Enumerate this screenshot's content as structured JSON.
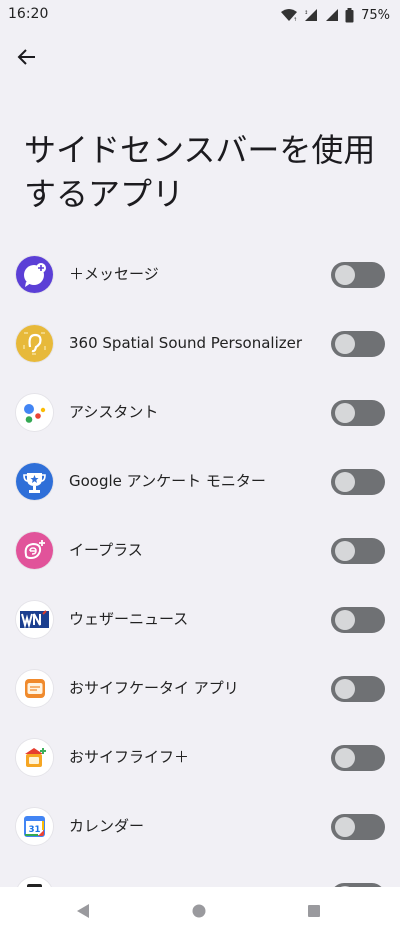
{
  "status_bar": {
    "time": "16:20",
    "battery": "75%"
  },
  "header": {
    "back_icon": "arrow-left-icon",
    "title": "サイドセンスバーを使用するアプリ"
  },
  "apps": [
    {
      "label": "＋メッセージ",
      "icon": "plus-message-icon",
      "enabled": false
    },
    {
      "label": "360 Spatial Sound Personalizer",
      "icon": "ear-icon",
      "enabled": false
    },
    {
      "label": "アシスタント",
      "icon": "google-assistant-icon",
      "enabled": false
    },
    {
      "label": "Google アンケート モニター",
      "icon": "trophy-icon",
      "enabled": false
    },
    {
      "label": "イープラス",
      "icon": "eplus-icon",
      "enabled": false
    },
    {
      "label": "ウェザーニュース",
      "icon": "weathernews-icon",
      "enabled": false
    },
    {
      "label": "おサイフケータイ アプリ",
      "icon": "osaifu-keitai-icon",
      "enabled": false
    },
    {
      "label": "おサイフライフ＋",
      "icon": "osaifu-life-icon",
      "enabled": false
    },
    {
      "label": "カレンダー",
      "icon": "calendar-icon",
      "enabled": false
    },
    {
      "label": "",
      "icon": "partial-app-icon",
      "enabled": false
    }
  ],
  "calendar_day": "31",
  "colors": {
    "background": "#f1f0f5",
    "toggle_off_track": "#6f7174",
    "toggle_off_knob": "#d6d7d9"
  },
  "nav_bar": {
    "back": "nav-back-icon",
    "home": "nav-home-icon",
    "recents": "nav-recents-icon"
  }
}
